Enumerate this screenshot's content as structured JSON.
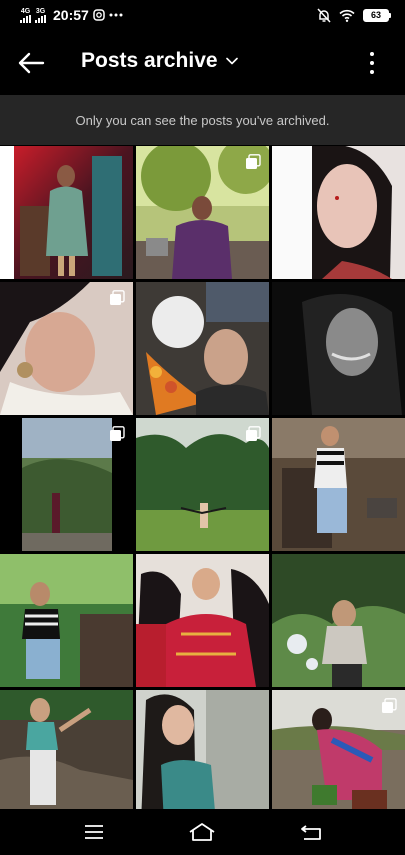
{
  "status_bar": {
    "net1_label": "4G",
    "net2_label": "3G",
    "time": "20:57",
    "battery": "63",
    "icons": [
      "instagram-icon",
      "more-dots-icon",
      "mute-bell-icon",
      "wifi-icon",
      "battery-icon"
    ]
  },
  "header": {
    "title": "Posts archive",
    "back_icon": "arrow-left-icon",
    "dropdown_icon": "chevron-down-icon",
    "menu_icon": "more-vertical-icon"
  },
  "notice": {
    "text": "Only you can see the posts you've archived."
  },
  "grid": {
    "posts": [
      {
        "multi": false
      },
      {
        "multi": true
      },
      {
        "multi": false
      },
      {
        "multi": true
      },
      {
        "multi": false
      },
      {
        "multi": false
      },
      {
        "multi": true
      },
      {
        "multi": true
      },
      {
        "multi": false
      },
      {
        "multi": false
      },
      {
        "multi": false
      },
      {
        "multi": false
      },
      {
        "multi": false
      },
      {
        "multi": false
      },
      {
        "multi": true
      }
    ]
  },
  "nav_bar": {
    "icons": [
      "menu-icon",
      "home-icon",
      "back-icon"
    ]
  },
  "colors": {
    "background": "#000000",
    "notice_bg": "#262626",
    "notice_text": "#c8c8c8"
  }
}
